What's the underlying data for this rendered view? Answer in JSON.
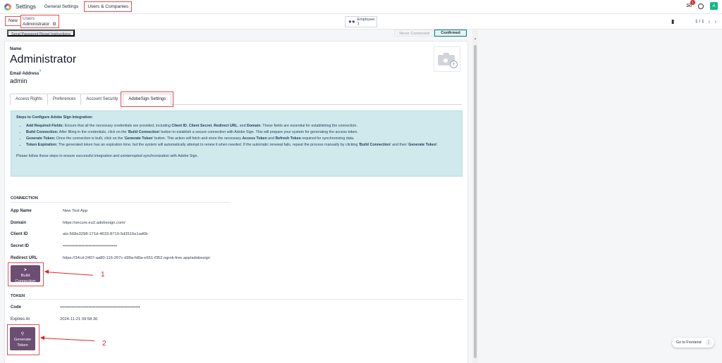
{
  "topbar": {
    "app_title": "Settings",
    "menu": [
      "General Settings",
      "Users & Companies"
    ],
    "chat_badge": "1",
    "avatar_letter": "A"
  },
  "control": {
    "new_label": "New",
    "breadcrumb_parent": "Users",
    "breadcrumb_current": "Administrator",
    "employee_label": "Employee",
    "employee_count": "1",
    "pager": "1 / 1"
  },
  "status": {
    "reset_label": "Send Password Reset Instructions",
    "never_connected": "Never Connected",
    "confirmed": "Confirmed"
  },
  "form": {
    "name_label": "Name",
    "name_value": "Administrator",
    "email_label": "Email Address",
    "email_help": "?",
    "email_value": "admin"
  },
  "tabs": [
    "Access Rights",
    "Preferences",
    "Account Security",
    "AdobeSign Settings"
  ],
  "alert": {
    "title": "Steps to Configure Adobe Sign Integration:",
    "items": [
      {
        "bold": "Add Required Fields:",
        "text": " Ensure that all the necessary credentials are provided, including ",
        "b1": "Client ID",
        "t2": ", ",
        "b2": "Client Secret",
        "t3": ", ",
        "b3": "Redirect URL",
        "t4": ", and ",
        "b4": "Domain",
        "t5": ". These fields are essential for establishing the connection."
      },
      {
        "bold": "Build Connection:",
        "text": " After filling in the credentials, click on the '",
        "b1": "Build Connection",
        "t2": "' button to establish a secure connection with Adobe Sign. This will prepare your system for generating the access token."
      },
      {
        "bold": "Generate Token:",
        "text": " Once the connection is built, click on the '",
        "b1": "Generate Token",
        "t2": "' button. This action will fetch and store the necessary ",
        "b2": "Access Token",
        "t3": " and ",
        "b3": "Refresh Token",
        "t4": " required for synchronizing data."
      },
      {
        "bold": "Token Expiration:",
        "text": " The generated token has an expiration time, but the system will automatically attempt to renew it when needed. If the automatic renewal fails, repeat the process manually by clicking '",
        "b1": "Build Connection",
        "t2": "' and then '",
        "b2": "Generate Token",
        "t3": "'."
      }
    ],
    "footer": "Please follow these steps to ensure successful integration and uninterrupted synchronization with Adobe Sign."
  },
  "connection": {
    "section_title": "CONNECTION",
    "fields": [
      {
        "label": "App Name",
        "value": "New Test App"
      },
      {
        "label": "Domain",
        "value": "https://secure.eu2.adobesign.com/"
      },
      {
        "label": "Client ID",
        "value": "ats-568e3298-171d-4633-8719-5d3516e1ad0b"
      },
      {
        "label": "Secret ID",
        "value": "••••••••••••••••••••••••••••••••••••••"
      },
      {
        "label": "Redirect URL",
        "value": "https://34cd-2407-aa80-116-267c-d99a-fd0a-e651-f352.ngrok-free.app/adobesign"
      }
    ],
    "button_line1": "Build",
    "button_line2": "Connection"
  },
  "token": {
    "section_title": "TOKEN",
    "fields": [
      {
        "label": "Code",
        "value": "••••••••••••••••••••••••••••••••••••••••••••••••••••••••"
      },
      {
        "label": "Expires At",
        "value": "2024-11-21 09:58:36"
      }
    ],
    "button_line1": "Generate",
    "button_line2": "Token"
  },
  "annotations": [
    "1",
    "2"
  ],
  "frontend_label": "Go to Frontend",
  "colors": {
    "accent": "#6b4e71",
    "annotation": "#dc2626",
    "alert_bg": "#cfe9ec"
  }
}
